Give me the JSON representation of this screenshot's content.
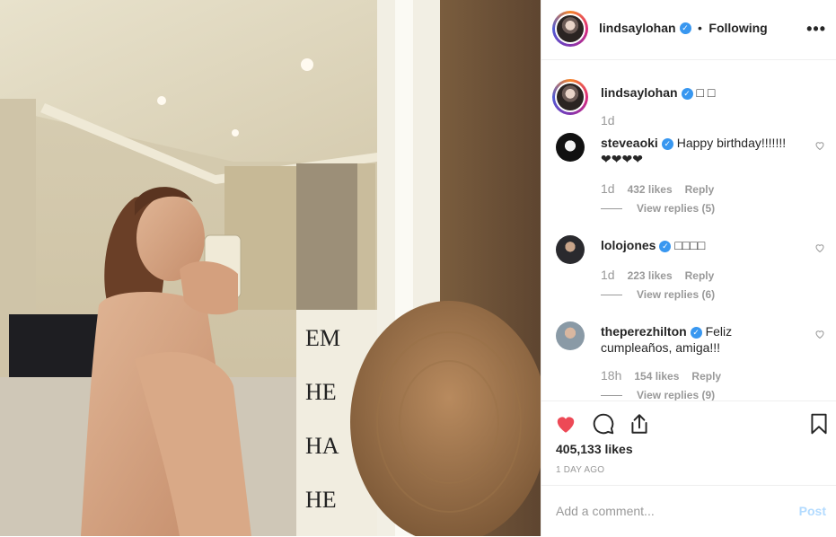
{
  "post": {
    "author": "lindsaylohan",
    "verified_badge": "✓",
    "separator": "•",
    "follow_status": "Following",
    "more_icon": "•••",
    "caption_text": "□ □",
    "caption_time": "1d"
  },
  "comments": [
    {
      "user": "steveaoki",
      "text": "Happy birthday!!!!!!! ❤❤❤❤",
      "time": "1d",
      "likes": "432 likes",
      "reply": "Reply",
      "view_replies": "View replies (5)"
    },
    {
      "user": "lolojones",
      "text": "□□□□",
      "time": "1d",
      "likes": "223 likes",
      "reply": "Reply",
      "view_replies": "View replies (6)"
    },
    {
      "user": "theperezhilton",
      "text": "Feliz cumpleaños, amiga!!!",
      "time": "18h",
      "likes": "154 likes",
      "reply": "Reply",
      "view_replies": "View replies (9)"
    }
  ],
  "actions": {
    "like_icon": "heart-filled-icon",
    "comment_icon": "comment-icon",
    "share_icon": "share-icon",
    "save_icon": "bookmark-icon",
    "like_color": "#ed4956"
  },
  "likes_count": "405,133 likes",
  "time_ago": "1 DAY AGO",
  "comment_box": {
    "placeholder": "Add a comment...",
    "post_label": "Post"
  }
}
